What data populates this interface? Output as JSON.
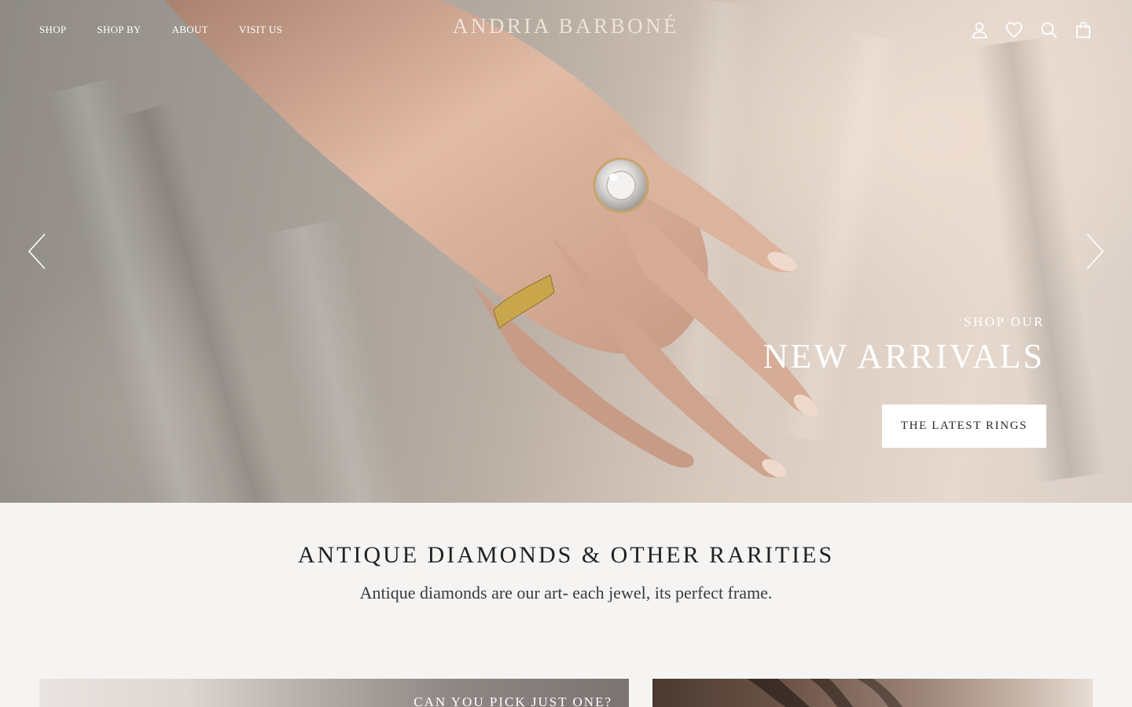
{
  "brand": {
    "logo_text": "ANDRIA BARBONÉ"
  },
  "nav": {
    "links": [
      {
        "label": "SHOP"
      },
      {
        "label": "SHOP BY"
      },
      {
        "label": "ABOUT"
      },
      {
        "label": "VISIT US"
      }
    ],
    "icons": [
      "account-icon",
      "wishlist-heart-icon",
      "search-icon",
      "cart-bag-icon"
    ]
  },
  "hero": {
    "eyebrow": "SHOP OUR",
    "title": "NEW ARRIVALS",
    "cta_label": "THE LATEST RINGS",
    "prev_icon": "chevron-left-icon",
    "next_icon": "chevron-right-icon"
  },
  "intro": {
    "title": "ANTIQUE DIAMONDS & OTHER RARITIES",
    "subtitle": "Antique diamonds are our art- each jewel, its perfect frame."
  },
  "tiles": [
    {
      "label": "CAN YOU PICK JUST ONE?"
    },
    {
      "label": ""
    }
  ],
  "colors": {
    "page_background": "#f5f4f2",
    "logo": "#efe3d6",
    "heading_text": "#222222",
    "button_background": "#ffffff"
  }
}
